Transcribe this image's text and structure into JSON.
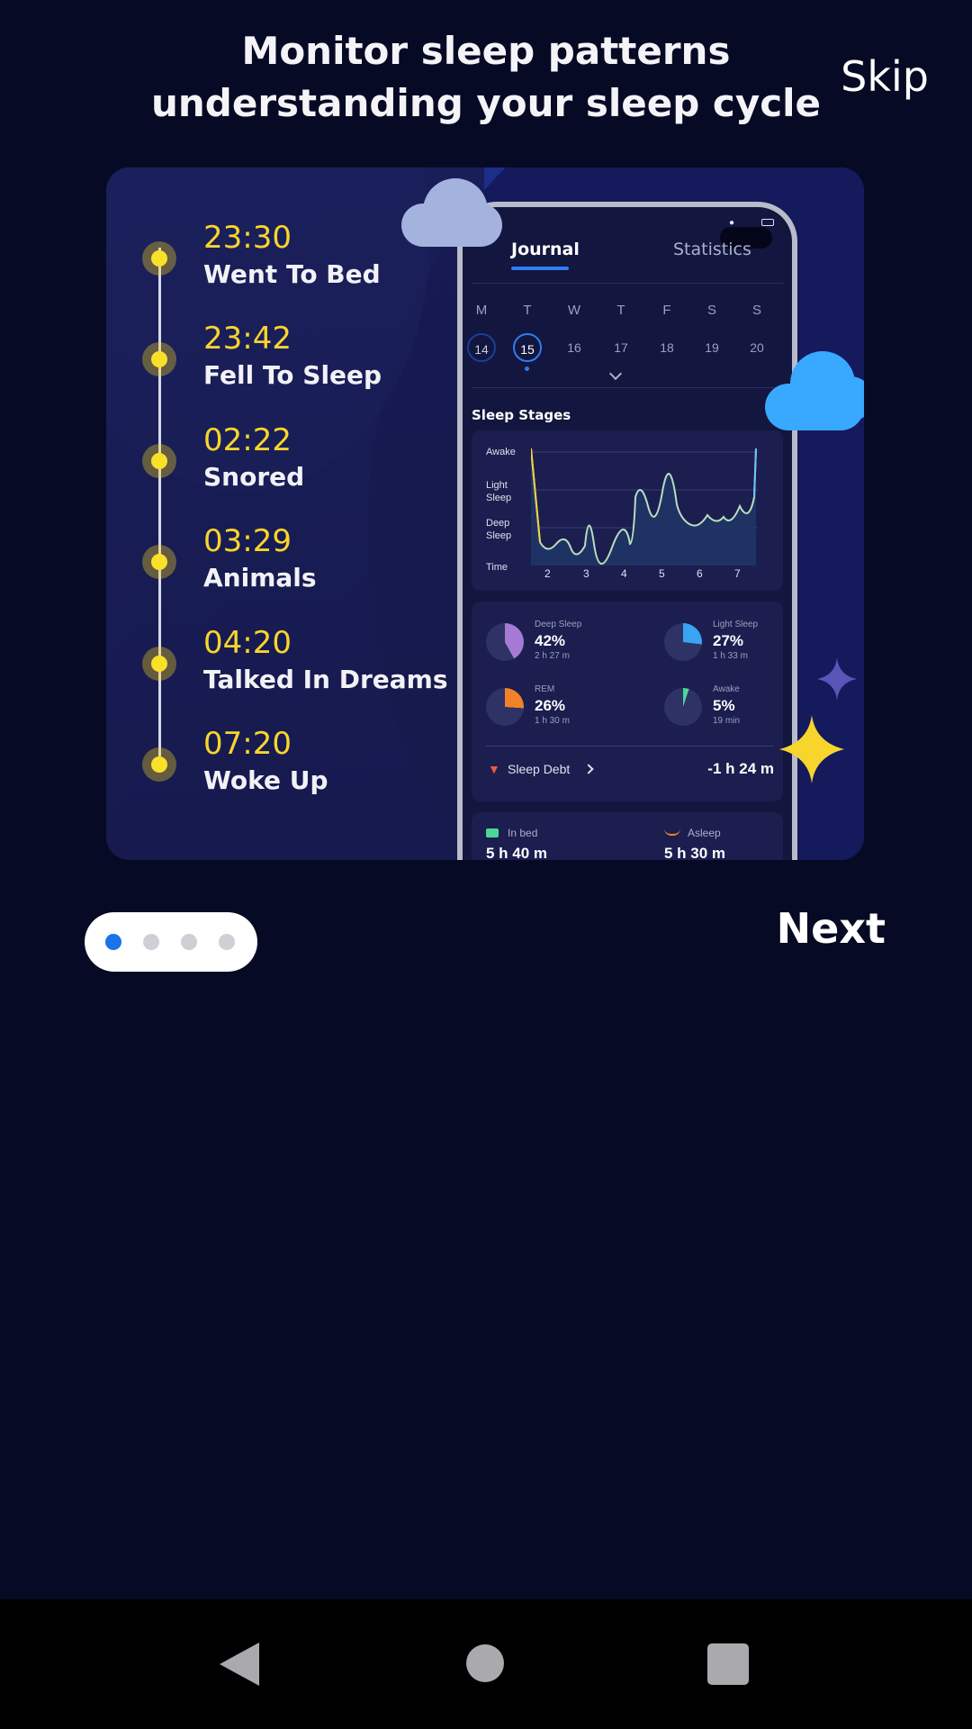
{
  "header": {
    "title_line1": "Monitor sleep patterns",
    "title_line2": "understanding your sleep cycle",
    "skip_label": "Skip"
  },
  "timeline": [
    {
      "time": "23:30",
      "label": "Went To Bed"
    },
    {
      "time": "23:42",
      "label": "Fell To Sleep"
    },
    {
      "time": "02:22",
      "label": "Snored"
    },
    {
      "time": "03:29",
      "label": "Animals"
    },
    {
      "time": "04:20",
      "label": "Talked In Dreams"
    },
    {
      "time": "07:20",
      "label": "Woke Up"
    }
  ],
  "phone": {
    "tabs": {
      "journal": "Journal",
      "statistics": "Statistics"
    },
    "weekdays": [
      "M",
      "T",
      "W",
      "T",
      "F",
      "S",
      "S"
    ],
    "dates": [
      "14",
      "15",
      "16",
      "17",
      "18",
      "19",
      "20"
    ],
    "sleep_stages_title": "Sleep Stages",
    "chart": {
      "y_labels": [
        "Awake",
        "Light\nSleep",
        "Deep\nSleep",
        "Time"
      ],
      "x_labels": [
        "2",
        "3",
        "4",
        "5",
        "6",
        "7"
      ]
    },
    "stats": {
      "deep": {
        "name": "Deep Sleep",
        "pct": "42%",
        "dur": "2 h 27 m",
        "fraction": 0.42,
        "color": "#a57ad6"
      },
      "light": {
        "name": "Light Sleep",
        "pct": "27%",
        "dur": "1 h 33 m",
        "fraction": 0.27,
        "color": "#3aa3f2"
      },
      "rem": {
        "name": "REM",
        "pct": "26%",
        "dur": "1 h 30 m",
        "fraction": 0.26,
        "color": "#f2822a"
      },
      "awake": {
        "name": "Awake",
        "pct": "5%",
        "dur": "19 min",
        "fraction": 0.05,
        "color": "#4ed69a"
      }
    },
    "sleep_debt": {
      "label": "Sleep Debt",
      "value": "-1 h 24 m"
    },
    "bottom": {
      "in_bed": "In bed",
      "asleep": "Asleep",
      "in_bed_value": "5 h 40 m",
      "asleep_value": "5 h 30 m"
    }
  },
  "pager": {
    "count": 4,
    "active": 0,
    "active_color": "#1a73e8"
  },
  "next_label": "Next"
}
